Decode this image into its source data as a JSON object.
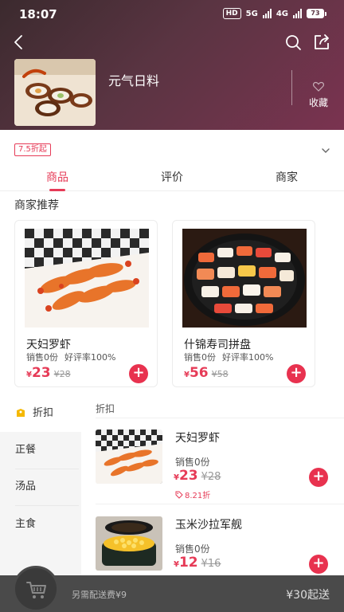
{
  "status_bar": {
    "time": "18:07",
    "hd": "HD",
    "net5g": "5G",
    "net4g": "4G",
    "battery": "73"
  },
  "header": {
    "back_icon": "chevron-left-icon",
    "search_icon": "search-icon",
    "share_icon": "share-icon",
    "store_name": "元气日料",
    "favorite_label": "收藏"
  },
  "promo": {
    "tag": "7.5折起"
  },
  "tabs": [
    {
      "label": "商品",
      "active": true
    },
    {
      "label": "评价",
      "active": false
    },
    {
      "label": "商家",
      "active": false
    }
  ],
  "recommend": {
    "title": "商家推荐",
    "items": [
      {
        "name": "天妇罗虾",
        "sales": "销售0份",
        "rating": "好评率100%",
        "currency": "¥",
        "price": "23",
        "original": "¥28"
      },
      {
        "name": "什锦寿司拼盘",
        "sales": "销售0份",
        "rating": "好评率100%",
        "currency": "¥",
        "price": "56",
        "original": "¥58"
      }
    ]
  },
  "sidebar": {
    "items": [
      {
        "label": "折扣",
        "active": true
      },
      {
        "label": "正餐",
        "active": false
      },
      {
        "label": "汤品",
        "active": false
      },
      {
        "label": "主食",
        "active": false
      }
    ]
  },
  "list": {
    "category": "折扣",
    "items": [
      {
        "name": "天妇罗虾",
        "sales": "销售0份",
        "currency": "¥",
        "price": "23",
        "original": "¥28",
        "discount": "8.21折"
      },
      {
        "name": "玉米沙拉军舰",
        "sales": "销售0份",
        "currency": "¥",
        "price": "12",
        "original": "¥16",
        "discount": ""
      }
    ]
  },
  "cart": {
    "note": "另需配送费¥9",
    "min_order": "¥30起送"
  },
  "colors": {
    "accent": "#e63b57",
    "header_start": "#3b2a2e",
    "header_end": "#7a3350",
    "cart_bar": "#4a4a4a"
  }
}
